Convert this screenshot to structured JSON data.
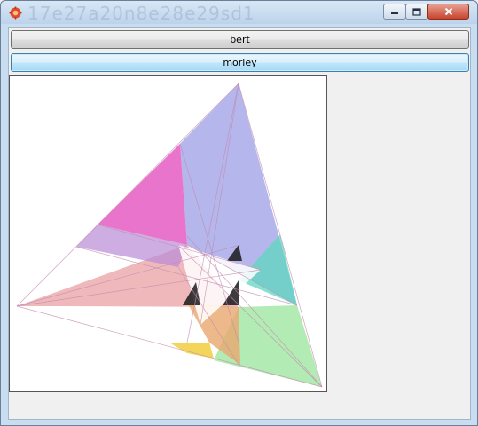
{
  "window": {
    "title": "",
    "icon": "app-gear-icon",
    "controls": {
      "minimize": "minimize-icon",
      "maximize": "maximize-icon",
      "close": "close-icon"
    }
  },
  "buttons": {
    "bert_label": "bert",
    "morley_label": "morley"
  },
  "canvas": {
    "description_shapes": "triangles",
    "colors": {
      "blue": "#9b9ee6",
      "magenta": "#e55cc3",
      "pink": "#e9a2a6",
      "green": "#9fe6a0",
      "teal": "#5fd7c0",
      "yellow": "#f2d04a",
      "orange": "#e8a86e",
      "purple": "#b98ad6",
      "dark": "#1a1a1a"
    }
  }
}
